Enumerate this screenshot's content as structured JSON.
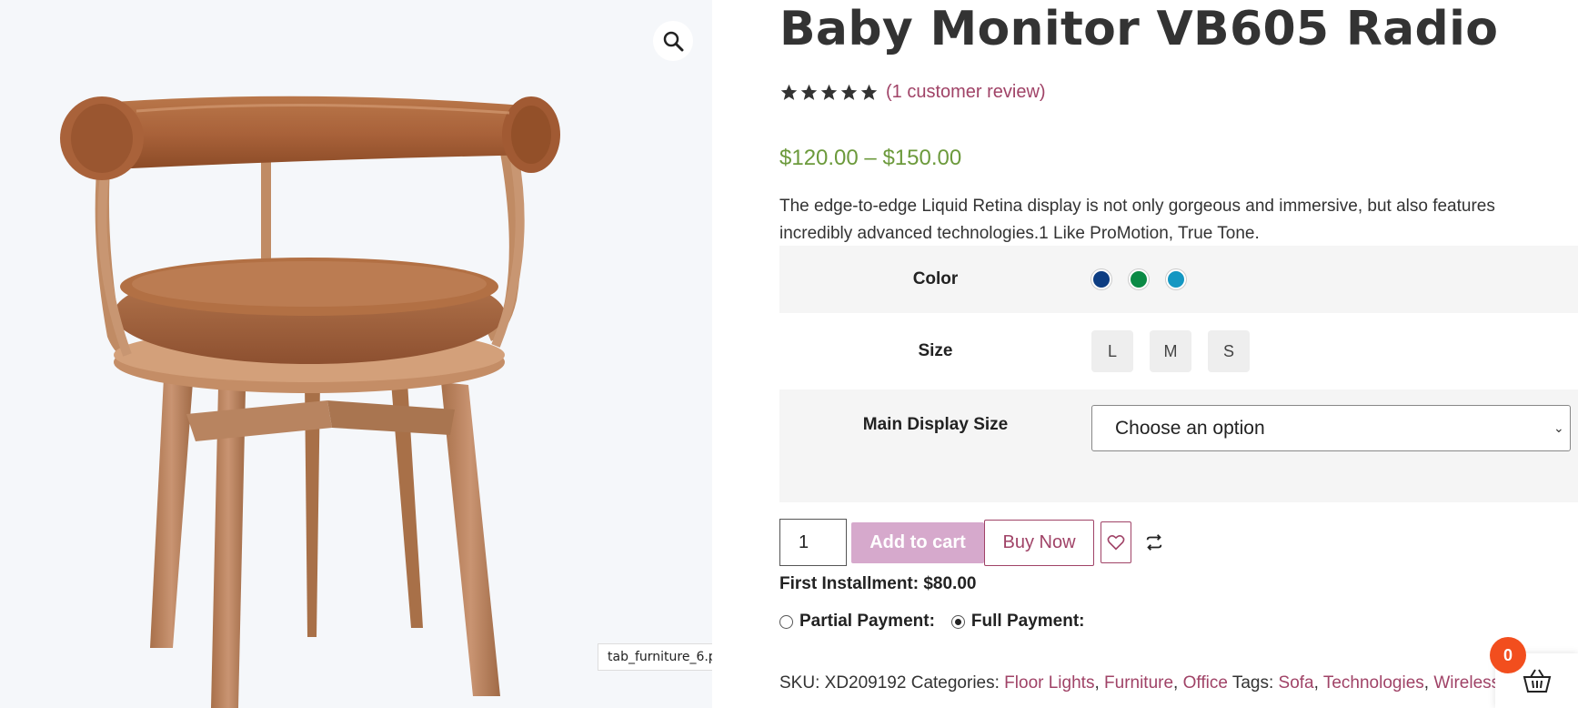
{
  "product": {
    "title": "Baby Monitor VB605 Radio",
    "rating_stars": 5,
    "review_text": "(1 customer review)",
    "price": "$120.00 – $150.00",
    "description": "The edge-to-edge Liquid Retina display is not only gorgeous and immersive, but also features incredibly advanced technologies.1 Like ProMotion, True Tone.",
    "image_filename": "tab_furniture_6.png"
  },
  "variations": {
    "color": {
      "label": "Color",
      "swatches": [
        {
          "name": "navy",
          "hex": "#0d3d82"
        },
        {
          "name": "green",
          "hex": "#0a8a45"
        },
        {
          "name": "teal",
          "hex": "#1497c2"
        }
      ]
    },
    "size": {
      "label": "Size",
      "options": [
        "L",
        "M",
        "S"
      ]
    },
    "display_size": {
      "label": "Main Display Size",
      "selected": "Choose an option"
    }
  },
  "cart": {
    "quantity": "1",
    "add_to_cart": "Add to cart",
    "buy_now": "Buy Now",
    "first_installment_label": "First Installment:",
    "first_installment_value": "$80.00",
    "partial_payment": "Partial Payment:",
    "full_payment": "Full Payment:",
    "selected_payment": "full",
    "badge_count": "0"
  },
  "meta": {
    "sku_label": "SKU:",
    "sku": "XD209192",
    "categories_label": "Categories:",
    "categories": [
      "Floor Lights",
      "Furniture",
      "Office"
    ],
    "tags_label": "Tags:",
    "tags": [
      "Sofa",
      "Technologies",
      "Wireless"
    ]
  },
  "icons": {
    "zoom": "search-icon",
    "wishlist": "heart-icon",
    "compare": "compare-arrows-icon",
    "cart": "basket-icon"
  },
  "colors": {
    "accent": "#a04367",
    "price_green": "#6c9a3c",
    "add_to_cart_bg": "#d6a9cc",
    "badge": "#f24e1e"
  }
}
